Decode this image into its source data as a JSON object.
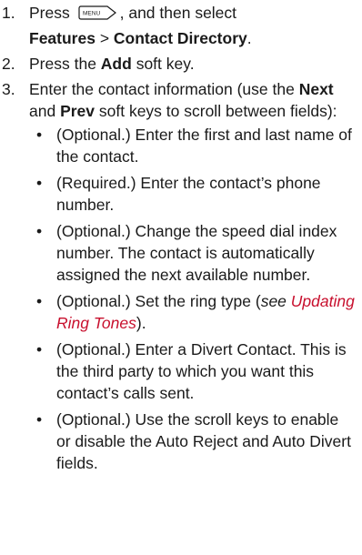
{
  "steps": [
    {
      "number": "1.",
      "text_a": "Press ",
      "key_icon": "menu-key-icon",
      "key_label": "MENU",
      "text_b": ", and then select",
      "bold1": "Features",
      "sep": " > ",
      "bold2": "Contact Directory",
      "end": "."
    },
    {
      "number": "2.",
      "text_a": "Press the ",
      "bold1": "Add",
      "text_b": " soft key."
    },
    {
      "number": "3.",
      "text_a": "Enter the contact information (use the ",
      "bold1": "Next",
      "text_b": " and ",
      "bold2": "Prev",
      "text_c": " soft keys to scroll between fields):",
      "bullets": [
        {
          "text": "(Optional.) Enter the first and last name of the contact."
        },
        {
          "text": "(Required.) Enter the contact’s phone number."
        },
        {
          "text": "(Optional.) Change the speed dial index number. The contact is automatically assigned the next available number."
        },
        {
          "text_a": "(Optional.) Set the ring type (",
          "italic": "see",
          "space": " ",
          "link": "Updating Ring Tones",
          "text_b": ")."
        },
        {
          "text": "(Optional.) Enter a Divert Contact. This is the third party to which you want this contact’s calls sent."
        },
        {
          "text": "(Optional.) Use the scroll keys to enable or disable the Auto Reject and Auto Divert fields."
        }
      ]
    }
  ],
  "bullet_char": "•",
  "colors": {
    "text": "#1a1a1a",
    "link": "#c8102e"
  }
}
